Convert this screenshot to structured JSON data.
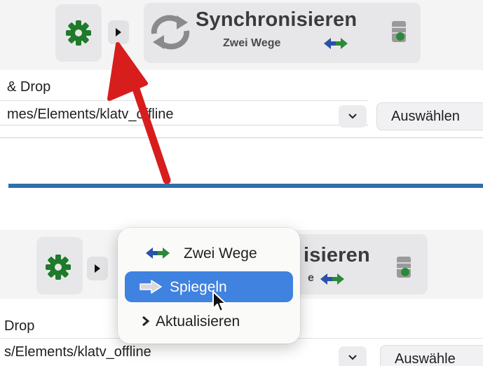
{
  "top": {
    "sync_title": "Synchronisieren",
    "sync_mode": "Zwei Wege",
    "drag_label": "& Drop",
    "path_value": "mes/Elements/klatv_offline",
    "choose_label": "Auswählen"
  },
  "bottom": {
    "sync_title_partial": "isieren",
    "sync_mode_partial": "e",
    "drag_label": "Drop",
    "path_value": "s/Elements/klatv_offline",
    "choose_label": "Auswähle"
  },
  "menu": {
    "items": [
      {
        "label": "Zwei Wege",
        "icon": "double-arrow-icon",
        "selected": false
      },
      {
        "label": "Spiegeln",
        "icon": "right-arrow-icon",
        "selected": true
      },
      {
        "label": "Aktualisieren",
        "icon": "chevron-right-icon",
        "selected": false
      }
    ]
  },
  "colors": {
    "gear_green": "#1f7a2a",
    "arrow_blue": "#2a52a8",
    "arrow_green": "#2a8a3a",
    "highlight_blue": "#3f82e0",
    "annotation_red": "#d81d1d",
    "divider_blue": "#2f6fa8"
  }
}
